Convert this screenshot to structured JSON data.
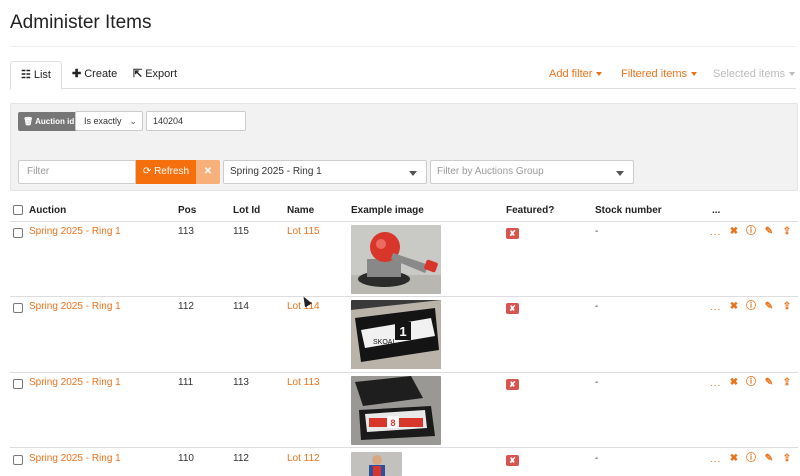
{
  "page": {
    "title": "Administer Items"
  },
  "tabs": {
    "list": "List",
    "create": "Create",
    "export": "Export",
    "add_filter": "Add filter",
    "filtered_items": "Filtered items",
    "selected_items": "Selected items"
  },
  "filters": {
    "auction_id_label": "Auction id",
    "operator": "Is exactly",
    "auction_id_value": "140204",
    "search_placeholder": "Filter",
    "refresh_label": "Refresh",
    "clear_label": "✕",
    "auction_select": "Spring 2025 - Ring 1",
    "group_placeholder": "Filter by Auctions Group"
  },
  "table": {
    "headers": {
      "auction": "Auction",
      "pos": "Pos",
      "lot_id": "Lot Id",
      "name": "Name",
      "image": "Example image",
      "featured": "Featured?",
      "stock": "Stock number",
      "more": "..."
    },
    "rows": [
      {
        "auction": "Spring 2025 - Ring 1",
        "pos": "113",
        "lot_id": "115",
        "name": "Lot 115",
        "featured": "✘",
        "stock": "-",
        "more": "..."
      },
      {
        "auction": "Spring 2025 - Ring 1",
        "pos": "112",
        "lot_id": "114",
        "name": "Lot 114",
        "featured": "✘",
        "stock": "-",
        "more": "..."
      },
      {
        "auction": "Spring 2025 - Ring 1",
        "pos": "111",
        "lot_id": "113",
        "name": "Lot 113",
        "featured": "✘",
        "stock": "-",
        "more": "..."
      },
      {
        "auction": "Spring 2025 - Ring 1",
        "pos": "110",
        "lot_id": "112",
        "name": "Lot 112",
        "featured": "✘",
        "stock": "-",
        "more": "..."
      }
    ]
  },
  "icons": {
    "list": "list-icon",
    "create": "plus-icon",
    "export": "export-icon",
    "refresh": "refresh-icon",
    "delete": "delete-icon",
    "info": "info-icon",
    "edit": "pencil-icon",
    "upload": "upload-icon",
    "not_featured": "cross-icon",
    "cursor": "mouse-pointer-icon"
  },
  "colors": {
    "accent": "#e8731c",
    "refresh_bg": "#f5700c",
    "danger": "#d9534f",
    "panel_bg": "#f2f2f2"
  }
}
